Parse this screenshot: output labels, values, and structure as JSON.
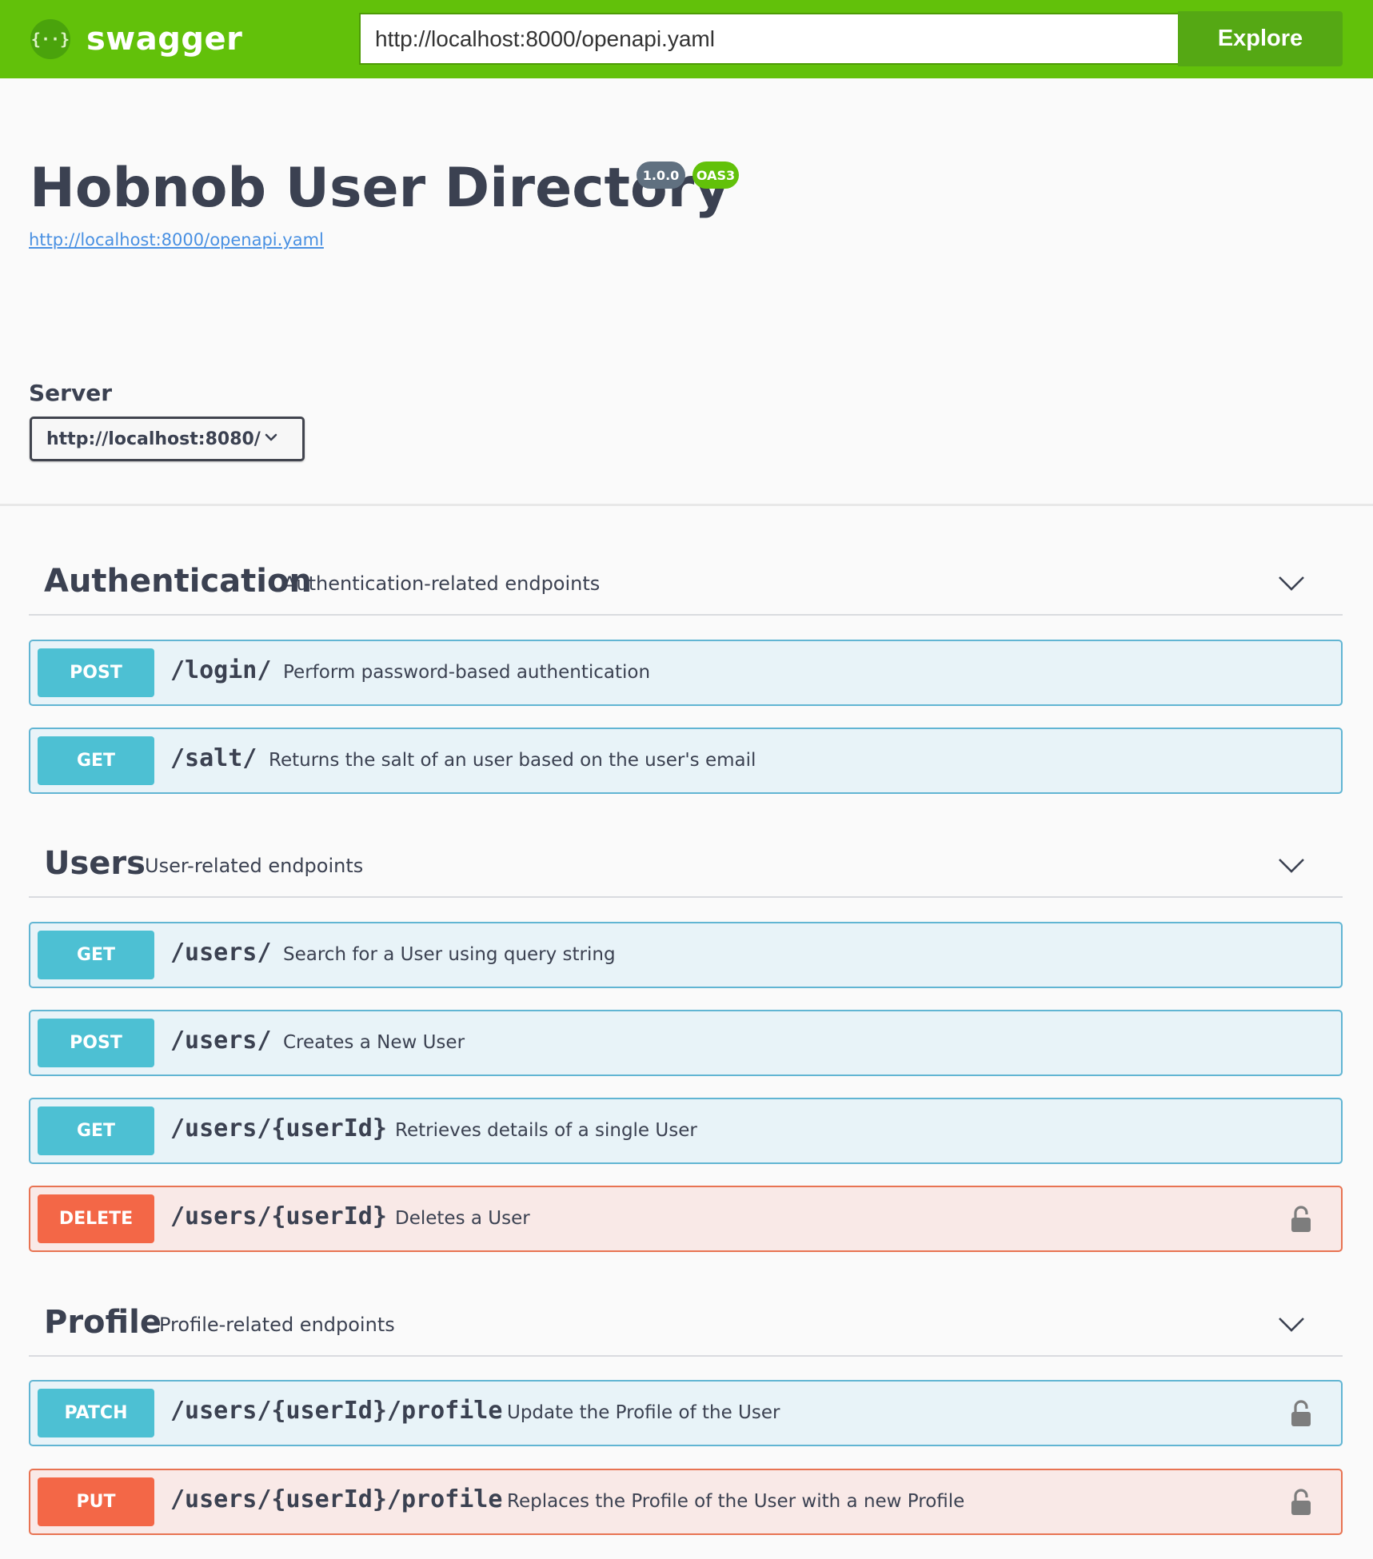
{
  "topbar": {
    "brand_logo_text": "{··}",
    "brand_name": "swagger",
    "url_value": "http://localhost:8000/openapi.yaml",
    "explore_label": "Explore",
    "background": "#62c10a"
  },
  "info": {
    "title": "Hobnob User Directory",
    "version_badge": "1.0.0",
    "oas_badge": "OAS3",
    "spec_link": "http://localhost:8000/openapi.yaml"
  },
  "server": {
    "label": "Server",
    "selected": "http://localhost:8080/"
  },
  "tags": [
    {
      "name": "Authentication",
      "description": "Authentication-related endpoints",
      "operations": [
        {
          "method": "POST",
          "path": "/login/",
          "summary": "Perform password-based authentication",
          "locked": false
        },
        {
          "method": "GET",
          "path": "/salt/",
          "summary": "Returns the salt of an user based on the user's email",
          "locked": false
        }
      ]
    },
    {
      "name": "Users",
      "description": "User-related endpoints",
      "operations": [
        {
          "method": "GET",
          "path": "/users/",
          "summary": "Search for a User using query string",
          "locked": false
        },
        {
          "method": "POST",
          "path": "/users/",
          "summary": "Creates a New User",
          "locked": false
        },
        {
          "method": "GET",
          "path": "/users/{userId}",
          "summary": "Retrieves details of a single User",
          "locked": false
        },
        {
          "method": "DELETE",
          "path": "/users/{userId}",
          "summary": "Deletes a User",
          "locked": true
        }
      ]
    },
    {
      "name": "Profile",
      "description": "Profile-related endpoints",
      "operations": [
        {
          "method": "PATCH",
          "path": "/users/{userId}/profile",
          "summary": "Update the Profile of the User",
          "locked": true
        },
        {
          "method": "PUT",
          "path": "/users/{userId}/profile",
          "summary": "Replaces the Profile of the User with a new Profile",
          "locked": true
        }
      ]
    }
  ],
  "colors": {
    "op_blue_bg": "#e8f3f8",
    "op_blue_border": "#61b5d3",
    "method_blue": "#4dc0d3",
    "op_red_bg": "#f9e9e7",
    "op_red_border": "#e87352",
    "method_red": "#f36747"
  },
  "icons": {
    "brand": "swagger-logo-icon",
    "server_dropdown": "chevron-down-icon",
    "tag_toggle": "chevron-down-icon",
    "auth": "lock-icon"
  }
}
